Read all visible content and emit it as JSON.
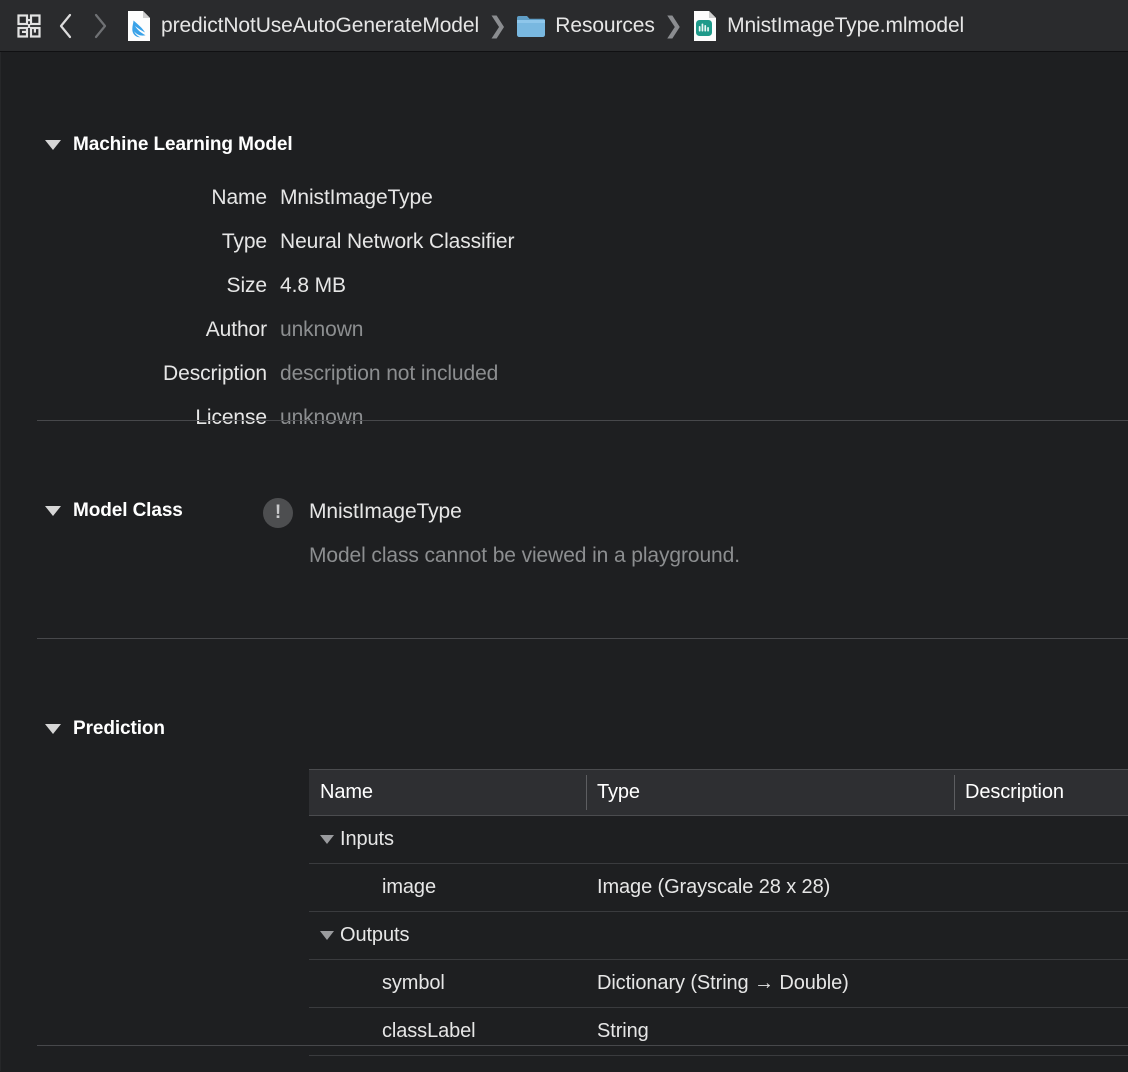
{
  "jumpbar": {
    "editor_options_icon": "grid-icon",
    "back_icon": "chevron-left-icon",
    "forward_icon": "chevron-right-icon",
    "separator": "❯",
    "crumbs": [
      {
        "label": "predictNotUseAutoGenerateModel",
        "icon": "swift-file-icon"
      },
      {
        "label": "Resources",
        "icon": "folder-icon"
      },
      {
        "label": "MnistImageType.mlmodel",
        "icon": "mlmodel-file-icon"
      }
    ]
  },
  "sections": {
    "model": {
      "title": "Machine Learning Model",
      "rows": [
        {
          "label": "Name",
          "value": "MnistImageType",
          "muted": false
        },
        {
          "label": "Type",
          "value": "Neural Network Classifier",
          "muted": false
        },
        {
          "label": "Size",
          "value": "4.8 MB",
          "muted": false
        },
        {
          "label": "Author",
          "value": "unknown",
          "muted": true
        },
        {
          "label": "Description",
          "value": "description not included",
          "muted": true
        },
        {
          "label": "License",
          "value": "unknown",
          "muted": true
        }
      ]
    },
    "model_class": {
      "title": "Model Class",
      "status_icon": "warning-exclamation-icon",
      "class_name": "MnistImageType",
      "note": "Model class cannot be viewed in a playground."
    },
    "prediction": {
      "title": "Prediction",
      "table": {
        "columns": [
          "Name",
          "Type",
          "Description"
        ],
        "groups": [
          {
            "label": "Inputs",
            "rows": [
              {
                "name": "image",
                "type": "Image (Grayscale 28 x 28)",
                "description": ""
              }
            ]
          },
          {
            "label": "Outputs",
            "rows": [
              {
                "name": "symbol",
                "type": "Dictionary (String → Double)",
                "description": ""
              },
              {
                "name": "classLabel",
                "type": "String",
                "description": ""
              }
            ]
          }
        ]
      }
    }
  },
  "colors": {
    "background": "#1e1f21",
    "jumpbar_background": "#2a2b2d",
    "table_header_background": "#2e2f32",
    "text_primary": "#e6e6e6",
    "text_muted": "#8c8e90",
    "divider": "#47484b",
    "swift_accent": "#3aa2e8",
    "folder_accent": "#6fb3dd",
    "mlmodel_accent": "#1f9a8a"
  }
}
